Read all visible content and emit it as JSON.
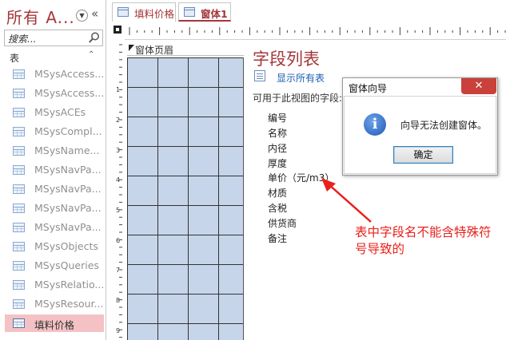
{
  "nav": {
    "title": "所有 A...",
    "search_placeholder": "搜索...",
    "group_label": "表",
    "items": [
      {
        "label": "MSysAccess..."
      },
      {
        "label": "MSysAccess..."
      },
      {
        "label": "MSysACEs"
      },
      {
        "label": "MSysCompl..."
      },
      {
        "label": "MSysName..."
      },
      {
        "label": "MSysNavPa..."
      },
      {
        "label": "MSysNavPa..."
      },
      {
        "label": "MSysNavPa..."
      },
      {
        "label": "MSysNavPa..."
      },
      {
        "label": "MSysObjects"
      },
      {
        "label": "MSysQueries"
      },
      {
        "label": "MSysRelatio..."
      },
      {
        "label": "MSysResour..."
      },
      {
        "label": "填料价格",
        "selected": true
      }
    ]
  },
  "tabs": [
    {
      "label": "填料价格"
    },
    {
      "label": "窗体1",
      "active": true
    }
  ],
  "designer": {
    "section_label": "窗体页眉",
    "ruler_left": [
      "1",
      "2",
      "3",
      "4",
      "5",
      "6",
      "7",
      "8",
      "9"
    ]
  },
  "field_list": {
    "title": "字段列表",
    "show_all": "显示所有表",
    "available_label": "可用于此视图的字段:",
    "fields": [
      "编号",
      "名称",
      "内径",
      "厚度",
      "单价（元/m3）",
      "材质",
      "含税",
      "供货商",
      "备注"
    ]
  },
  "dialog": {
    "title": "窗体向导",
    "message": "向导无法创建窗体。",
    "ok_label": "确定",
    "close_glyph": "✕"
  },
  "annotation": {
    "text": "表中字段名不能含特殊符号导致的",
    "color": "#e8211b"
  },
  "colors": {
    "accent": "#a4373a",
    "grid_fill": "#c6d5ea",
    "selected_item": "#f4c2c4"
  }
}
